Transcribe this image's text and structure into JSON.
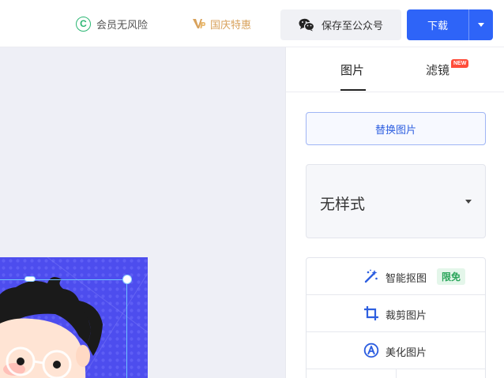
{
  "topbar": {
    "risk_free_label": "会员无风险",
    "risk_free_icon_letter": "C",
    "promo_label": "国庆特惠",
    "save_wechat_label": "保存至公众号",
    "download_label": "下载"
  },
  "panel": {
    "tabs": [
      {
        "label": "图片",
        "active": true
      },
      {
        "label": "滤镜",
        "active": false,
        "badge": "NEW"
      }
    ],
    "replace_label": "替换图片",
    "style_value": "无样式",
    "tools": [
      {
        "label": "智能抠图",
        "icon": "magic-wand-icon",
        "badge": "限免"
      },
      {
        "label": "裁剪图片",
        "icon": "crop-icon"
      },
      {
        "label": "美化图片",
        "icon": "beautify-icon"
      }
    ]
  },
  "colors": {
    "primary": "#2e64f8",
    "promo": "#d8a25c",
    "risk_free_icon": "#2bb673",
    "free_badge": "#2aa55a",
    "new_badge": "#ff4d3a",
    "artwork_bg": "#4d4dee",
    "canvas_bg": "#eeeff6"
  }
}
